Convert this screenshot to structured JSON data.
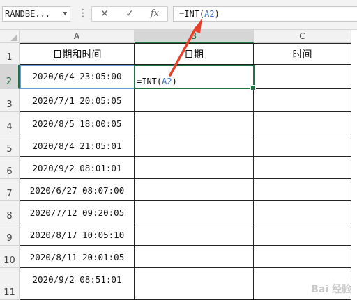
{
  "formula_bar": {
    "name_box": "RANDBE...",
    "formula_prefix": "=INT(",
    "formula_ref": "A2",
    "formula_suffix": ")",
    "cancel_glyph": "✕",
    "enter_glyph": "✓",
    "fx_label": "fx"
  },
  "columns": [
    "A",
    "B",
    "C"
  ],
  "rows": [
    "1",
    "2",
    "3",
    "4",
    "5",
    "6",
    "7",
    "8",
    "9",
    "10",
    "11"
  ],
  "headers": {
    "a": "日期和时间",
    "b": "日期",
    "c": "时间"
  },
  "datetimes": [
    "2020/6/4 23:05:00",
    "2020/7/1 20:05:05",
    "2020/8/5 18:00:05",
    "2020/8/4 21:05:01",
    "2020/9/2 08:01:01",
    "2020/6/27 08:07:00",
    "2020/7/12 09:20:05",
    "2020/8/17 10:05:10",
    "2020/8/11 20:01:05",
    "2020/9/2 08:51:01"
  ],
  "b2_formula": {
    "prefix": "=INT(",
    "ref": "A2",
    "suffix": ")"
  },
  "colors": {
    "accent_green": "#217346",
    "ref_blue": "#3a6fc6",
    "arrow_red": "#e8402a"
  }
}
